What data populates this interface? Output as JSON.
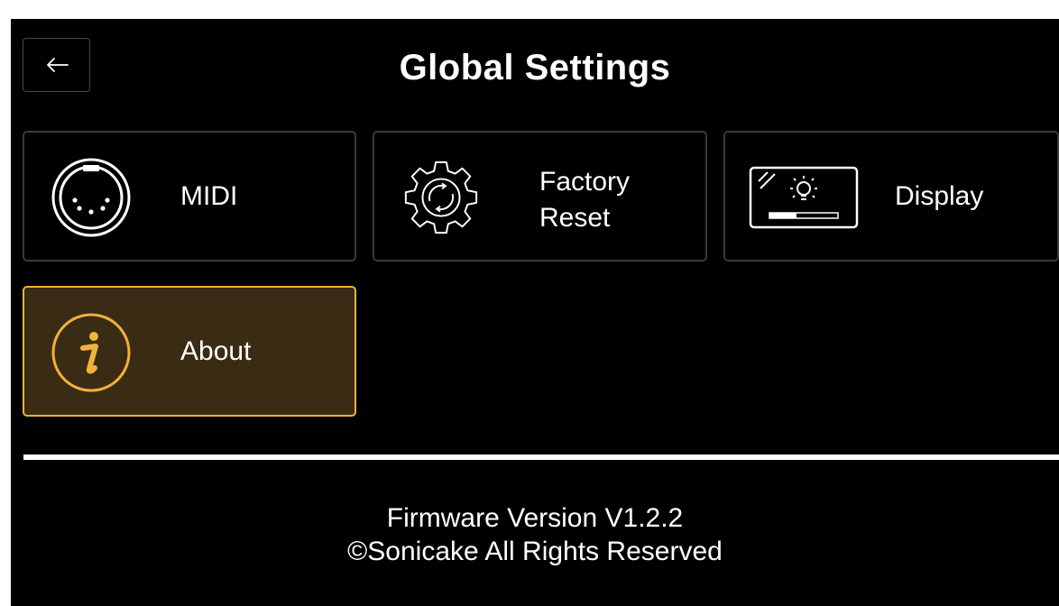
{
  "header": {
    "title": "Global Settings"
  },
  "tiles": [
    {
      "label": "MIDI",
      "icon": "midi-connector-icon"
    },
    {
      "label": "Factory\nReset",
      "icon": "factory-reset-gear-icon"
    },
    {
      "label": "Display",
      "icon": "display-brightness-icon"
    },
    {
      "label": "About",
      "icon": "info-icon"
    }
  ],
  "selected_tile": "About",
  "colors": {
    "background": "#000000",
    "accent": "#f0b23a",
    "selected_fill": "#3a2c14",
    "tile_border": "#3a3a3a"
  },
  "footer": {
    "firmware": "Firmware Version V1.2.2",
    "copyright": "©Sonicake All Rights Reserved"
  }
}
